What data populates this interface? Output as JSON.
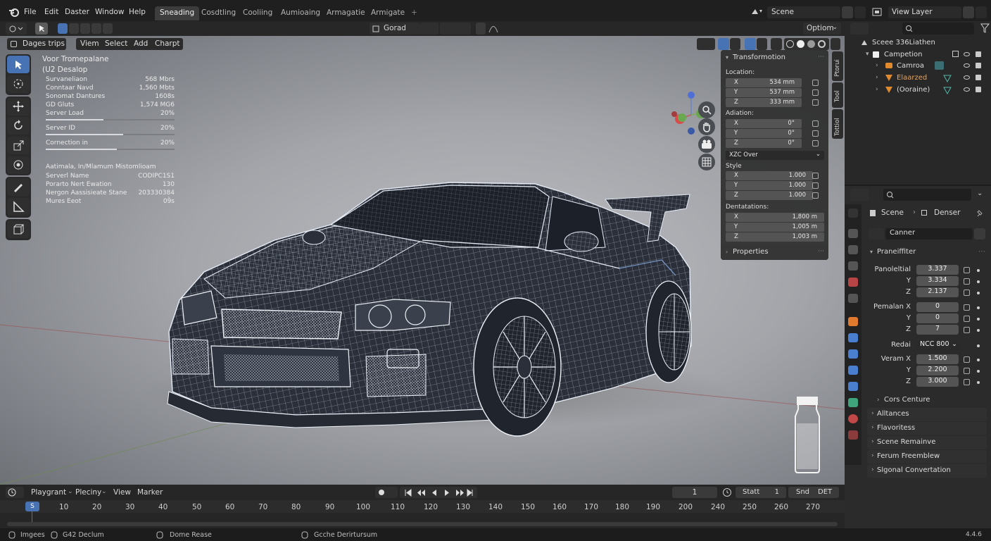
{
  "topbar": {
    "menus": [
      "File",
      "Edit",
      "Daster",
      "Window",
      "Help"
    ],
    "workspaces": [
      "Sneading",
      "Cosdtling",
      "Cooliing",
      "Aumioaing",
      "Armagatie",
      "Armigate"
    ],
    "add_tab": "+",
    "scene_label": "Scene",
    "view_layer_label": "View Layer"
  },
  "viewport_header": {
    "orientation": "Gorad",
    "options": "Optiom"
  },
  "viewport_menu": {
    "mode": "Dages trips",
    "items": [
      "Viem",
      "Select",
      "Add",
      "Charpt"
    ]
  },
  "overlay": {
    "title": "Voor Tromepalane",
    "subtitle": "(U2 Desalop",
    "stats": [
      {
        "label": "Survaneliaon",
        "value": "568 Mbrs"
      },
      {
        "label": "Conntaar Navd",
        "value": "1,560 Mbts"
      },
      {
        "label": "Sonomat Dantures",
        "value": "1608s"
      },
      {
        "label": "GD Gluts",
        "value": "1,574 MG6"
      }
    ],
    "bars": [
      {
        "label": "Server Load",
        "value": "20%",
        "fill": 0.45
      },
      {
        "label": "Server ID",
        "value": "20%",
        "fill": 0.6
      },
      {
        "label": "Cornection in",
        "value": "20%",
        "fill": 0.55
      }
    ],
    "section2_title": "Aatimala, In/Mlamum Mistomlioam",
    "stats2": [
      {
        "label": "Serverl Name",
        "value": "CODIPC1S1"
      },
      {
        "label": "Porarto Nert Ewation",
        "value": "130"
      },
      {
        "label": "Nergon Aassisieate Stane",
        "value": "203330384"
      },
      {
        "label": "Mures Eeot",
        "value": "09̀s"
      }
    ]
  },
  "npanel": {
    "transformation": "Transformotion",
    "location_label": "Location:",
    "location": [
      {
        "axis": "X",
        "value": "534 mm"
      },
      {
        "axis": "Y",
        "value": "537 mm"
      },
      {
        "axis": "Z",
        "value": "333 mm"
      }
    ],
    "adiation_label": "Adiation:",
    "adiation": [
      {
        "axis": "X",
        "value": "0°"
      },
      {
        "axis": "Y",
        "value": "0°"
      },
      {
        "axis": "Z",
        "value": "0°"
      }
    ],
    "dropdown": "XZC Over",
    "style_label": "Style",
    "style": [
      {
        "axis": "X",
        "value": "1.000"
      },
      {
        "axis": "Y",
        "value": "1.000"
      },
      {
        "axis": "Z",
        "value": "1.000"
      }
    ],
    "dentation_label": "Dentatations:",
    "dentation": [
      {
        "axis": "X",
        "value": "1,800 m"
      },
      {
        "axis": "Y",
        "value": "1,005 m"
      },
      {
        "axis": "Z",
        "value": "1,003 m"
      }
    ],
    "properties": "Properties",
    "tabs": [
      "Ptorui",
      "Tool",
      "Tottiol"
    ]
  },
  "outliner": {
    "scene": "Sceee 336Liathen",
    "collection": "Campetion",
    "items": [
      "Camroa",
      "Elaarzed",
      "(Ooraine)"
    ]
  },
  "properties": {
    "scene": "Scene",
    "denser": "Denser",
    "name": "Canner",
    "panel_title": "Praneiffiter",
    "group1_label": "Panoleltial",
    "group1": [
      {
        "axis": "",
        "value": "3.337"
      },
      {
        "axis": "Y",
        "value": "3.334"
      },
      {
        "axis": "Z",
        "value": "2.137"
      }
    ],
    "group2_label": "Pemalan X",
    "group2": [
      {
        "axis": "",
        "value": "0"
      },
      {
        "axis": "Y",
        "value": "0"
      },
      {
        "axis": "Z",
        "value": "7"
      }
    ],
    "redai_label": "Redai",
    "redai_value": "NCC 800",
    "group3_label": "Veram X",
    "group3": [
      {
        "axis": "",
        "value": "1.500"
      },
      {
        "axis": "Y",
        "value": "2.200"
      },
      {
        "axis": "Z",
        "value": "3.000"
      }
    ],
    "sub": "Cors Centure",
    "sections": [
      "Alltances",
      "Flavoritess",
      "Scene Remainve",
      "Ferum Freemblew",
      "Slgonal Convertation"
    ]
  },
  "timeline": {
    "mode": "Playgrant",
    "pleciny": "Pleciny",
    "view": "View",
    "marker": "Marker",
    "current_frame": "1",
    "start_label": "Statt",
    "start_value": "1",
    "end_label": "Snd",
    "end_value": "DET",
    "frame_marker": "S",
    "ticks": [
      "10",
      "20",
      "30",
      "40",
      "50",
      "60",
      "70",
      "80",
      "90",
      "100",
      "110",
      "120",
      "130",
      "140",
      "150",
      "160",
      "170",
      "180",
      "190",
      "200",
      "240",
      "250",
      "260",
      "270"
    ]
  },
  "statusbar": {
    "items": [
      "Imgees",
      "G42 Declum",
      "Dome Rease",
      "Gcche Derirtursum"
    ],
    "version": "4.4.6"
  },
  "colors": {
    "accent": "#4772b3",
    "wire": "#dfe6f2",
    "body": "#2a2f3a"
  }
}
